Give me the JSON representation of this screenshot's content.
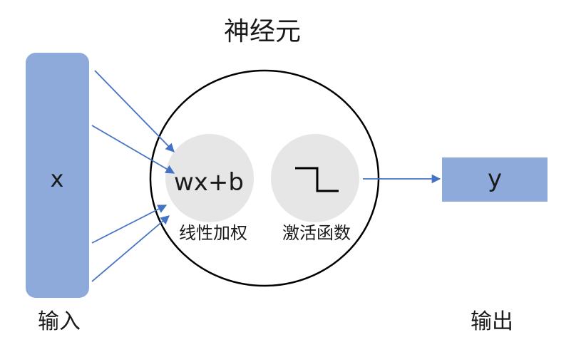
{
  "title": "神经元",
  "input": {
    "symbol": "x",
    "caption": "输入"
  },
  "neuron": {
    "linear": {
      "formula": "wx+b",
      "caption": "线性加权"
    },
    "activation": {
      "icon": "step-function-icon",
      "caption": "激活函数"
    }
  },
  "output": {
    "symbol": "y",
    "caption": "输出"
  },
  "colors": {
    "block": "#8eaadb",
    "arrow": "#4472c4",
    "inner_circle": "#e6e6e6",
    "outline": "#000000",
    "text": "#1a1a1a"
  }
}
